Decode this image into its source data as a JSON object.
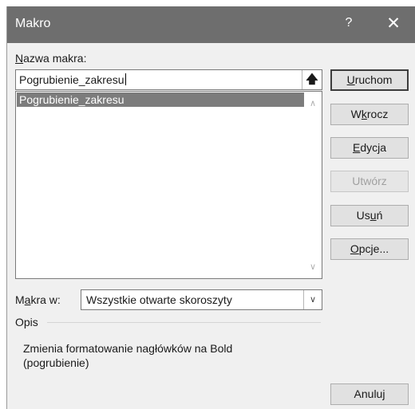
{
  "window": {
    "title": "Makro",
    "help_label": "?",
    "close_label": "✕"
  },
  "name_field": {
    "label_underlined": "N",
    "label_rest": "azwa makra:",
    "value": "Pogrubienie_zakresu",
    "up_button_label": "🡅"
  },
  "macro_list": {
    "items": [
      "Pogrubienie_zakresu"
    ],
    "selected_index": 0
  },
  "buttons": {
    "run": {
      "pre": "",
      "u": "U",
      "post": "ruchom"
    },
    "step_into": {
      "pre": "W",
      "u": "k",
      "post": "rocz"
    },
    "edit": {
      "pre": "",
      "u": "E",
      "post": "dycja"
    },
    "create": {
      "label": "Utwórz",
      "disabled": true
    },
    "delete": {
      "pre": "Us",
      "u": "u",
      "post": "ń"
    },
    "options": {
      "pre": "",
      "u": "O",
      "post": "pcje..."
    },
    "cancel": {
      "label": "Anuluj"
    }
  },
  "macros_in": {
    "label_pre": "M",
    "label_u": "a",
    "label_post": "kra w:",
    "selected": "Wszystkie otwarte skoroszyty"
  },
  "description": {
    "section_label": "Opis",
    "text_line1": "Zmienia formatowanie nagłówków na Bold",
    "text_line2": "(pogrubienie)"
  },
  "colors": {
    "titlebar": "#6e6e6e",
    "selection": "#7c7c7c",
    "dialog_bg": "#f0f0f0"
  }
}
